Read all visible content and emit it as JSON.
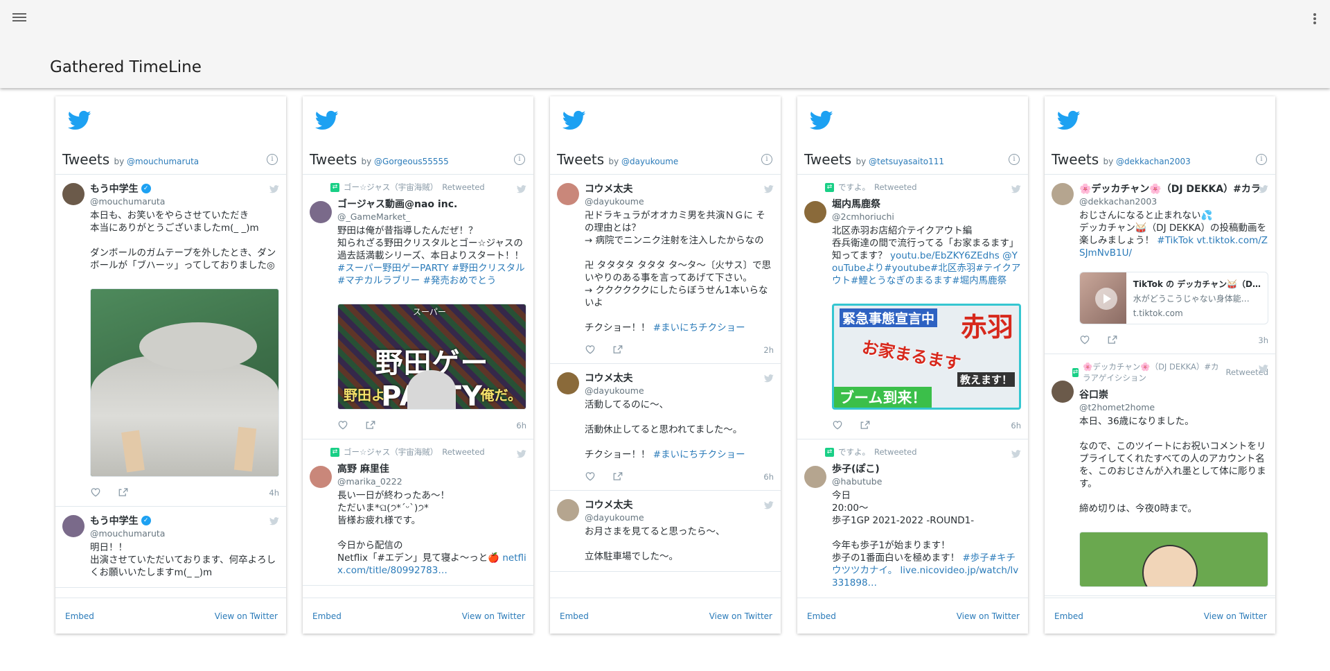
{
  "app": {
    "title": "Gathered TimeLine"
  },
  "common": {
    "header_tweets": "Tweets",
    "header_by": "by",
    "embed": "Embed",
    "view_on_twitter": "View on Twitter",
    "retweeted": "Retweeted",
    "twitter_blue": "#1da1f2",
    "link_blue": "#2b7bb9"
  },
  "columns": [
    {
      "owner": "@mouchumaruta",
      "tweets": [
        {
          "retweeted_by": "",
          "name": "もう中学生",
          "verified": true,
          "handle": "@mouchumaruta",
          "text": "本日も、お笑いをやらさせていただき\n本当にありがとうございましたm(_ _)m\n\nダンボールのガムテープを外したとき、ダンボールが「ブハーッ」ってしておりました◎",
          "media": "photo-green",
          "time": "4h"
        },
        {
          "retweeted_by": "",
          "name": "もう中学生",
          "verified": true,
          "handle": "@mouchumaruta",
          "text": "明日！！\n出演させていただいております、何卒よろしくお願いいたしますm(_ _)m",
          "media": "",
          "time": ""
        }
      ]
    },
    {
      "owner": "@Gorgeous55555",
      "tweets": [
        {
          "retweeted_by": "ゴー☆ジャス（宇宙海賊）",
          "name": "ゴージャス動画@nao inc.",
          "verified": false,
          "handle": "@_GameMarket_",
          "text": "野田は俺が昔指導したんだぜ！？\n知られざる野田クリスタルとゴー☆ジャスの過去話満載シリーズ、本日よりスタート！！",
          "links": "#スーパー野田ゲーPARTY #野田クリスタル#マヂカルラブリー #発売おめでとう",
          "media": "photo-noda",
          "media_text": "野田ゲーPARTY",
          "media_text2": "野田よ",
          "media_text3": "俺だ。",
          "media_small": "スーパー",
          "time": "6h"
        },
        {
          "retweeted_by": "ゴー☆ジャス（宇宙海賊）",
          "name": "高野 麻里佳",
          "verified": false,
          "handle": "@marika_0222",
          "text": "長い一日が終わったあ〜！\nただいま*ଘ(੭*ˊᵕˋ)੭*\n皆様お疲れ様です。\n\n今日から配信の\nNetflix「#エデン」見て寝よ〜っと🍎",
          "links": "netflix.com/title/80992783…",
          "media": "",
          "time": ""
        }
      ]
    },
    {
      "owner": "@dayukoume",
      "tweets": [
        {
          "retweeted_by": "",
          "name": "コウメ太夫",
          "verified": false,
          "handle": "@dayukoume",
          "text": "卍ドラキュラがオオカミ男を共演ＮＧに その理由とは？\n→ 病院でニンニク注射を注入したからなの\n\n卍 タタタタ タタタ タ〜タ〜〔火サス〕で思いやりのある事を言ってあげて下さい。\n→ ククククククにしたらぼうせん1本いらないよ\n\nチクショー！！",
          "links": "#まいにちチクショー",
          "media": "",
          "time": "2h"
        },
        {
          "retweeted_by": "",
          "name": "コウメ太夫",
          "verified": false,
          "handle": "@dayukoume",
          "text": "活動してるのに〜、\n\n活動休止してると思われてました〜。\n\nチクショー！！",
          "links": "#まいにちチクショー",
          "media": "",
          "time": "6h"
        },
        {
          "retweeted_by": "",
          "name": "コウメ太夫",
          "verified": false,
          "handle": "@dayukoume",
          "text": "お月さまを見てると思ったら〜、\n\n立体駐車場でした〜。",
          "links": "",
          "media": "",
          "time": ""
        }
      ]
    },
    {
      "owner": "@tetsuyasaito111",
      "tweets": [
        {
          "retweeted_by": "ですよ。",
          "name": "堀内馬鹿祭",
          "verified": false,
          "handle": "@2cmhoriuchi",
          "text": "北区赤羽お店紹介テイクアウト編\n呑兵衛達の間で流行ってる「お家まるます」知ってます？",
          "links": "youtu.be/EbZKY6ZEdhs @YouTubeより#youtube#北区赤羽#テイクアウト#鯉とうなぎのまるます#堀内馬鹿祭",
          "media": "photo-akabane",
          "media_text": "緊急事態宣言中",
          "media_text2": "赤羽",
          "media_text3": "お家まるます",
          "media_text4": "ブーム到来！",
          "media_text5": "教えます！",
          "time": "6h"
        },
        {
          "retweeted_by": "ですよ。",
          "name": "歩子(ぽこ)",
          "verified": false,
          "handle": "@habutube",
          "text": "今日\n20:00〜\n歩子1GP 2021-2022 -ROUND1-\n\n今年も歩子1が始まります！\n歩子の1番面白いを極めます！",
          "links": "#歩子#キチウツツカナイ。 live.nicovideo.jp/watch/lv331898…",
          "media": "",
          "time": ""
        }
      ]
    },
    {
      "owner": "@dekkachan2003",
      "tweets": [
        {
          "retweeted_by": "",
          "name": "🌸デッカチャン🌸（DJ DEKKA）#カラ",
          "verified": false,
          "handle": "@dekkachan2003",
          "text": "おじさんになると止まれない💦\nデッカチャン🥁（DJ DEKKA）の投稿動画を楽しみましょう！",
          "links": "#TikTok vt.tiktok.com/ZSJmNvB1U/",
          "card_title": "TikTok の デッカチャン🥁（D…",
          "card_desc": "水がどうこうじゃない身体能…",
          "card_url": "t.tiktok.com",
          "media": "card",
          "time": "3h"
        },
        {
          "retweeted_by": "🌸デッカチャン🌸（DJ DEKKA）#カラアゲイシション",
          "name": "谷口崇",
          "verified": false,
          "handle": "@t2homet2home",
          "text": "本日、36歳になりました。\n\nなので、このツイートにお祝いコメントをリプライしてくれたすべての人のアカウント名を、このおじさんが入れ墨として体に彫ります。\n\n締め切りは、今夜0時まで。",
          "links": "",
          "media": "photo-ojisan",
          "time": ""
        }
      ]
    }
  ]
}
